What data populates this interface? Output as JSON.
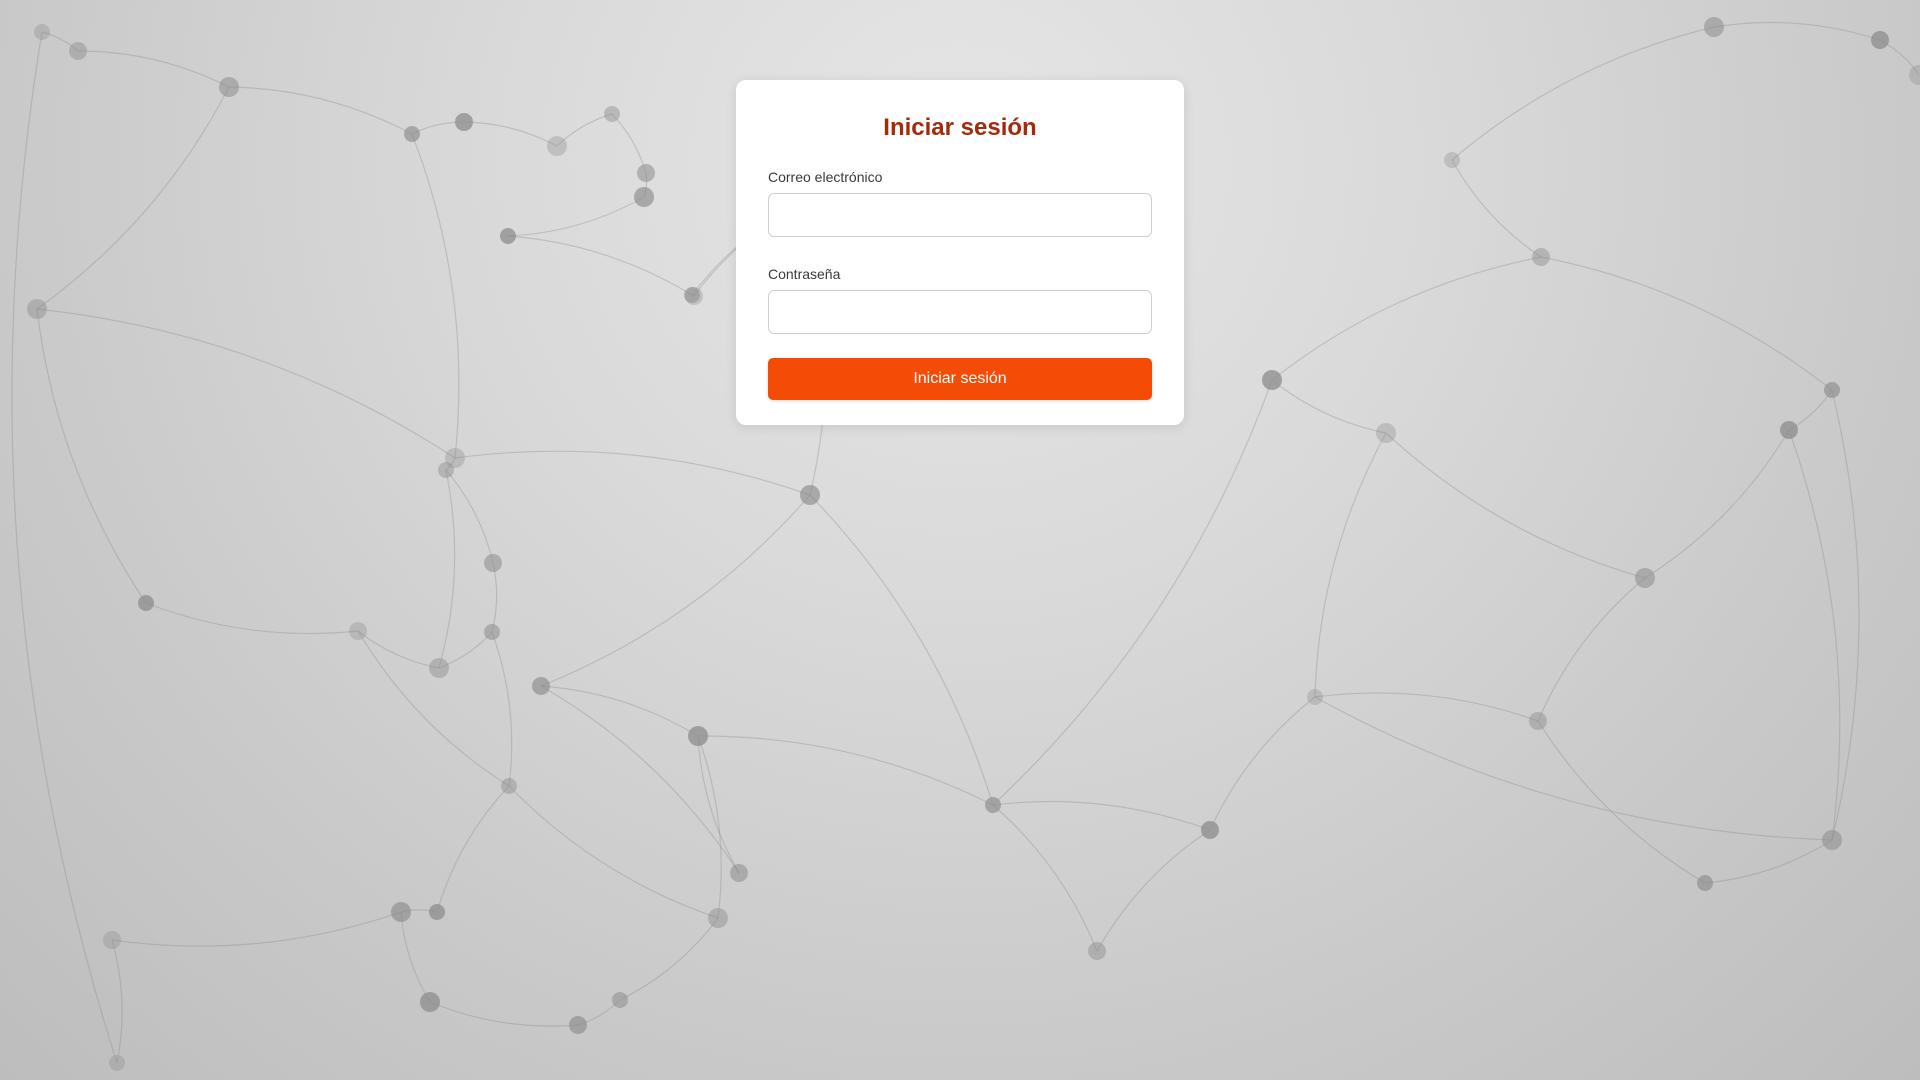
{
  "login": {
    "title": "Iniciar sesión",
    "email_label": "Correo electrónico",
    "email_value": "",
    "password_label": "Contraseña",
    "password_value": "",
    "submit_label": "Iniciar sesión"
  },
  "theme": {
    "title_color": "#a32a0b",
    "button_color": "#f44b06",
    "background_color": "#d9d9d9"
  },
  "background": {
    "icon": "network-graph-pattern"
  }
}
